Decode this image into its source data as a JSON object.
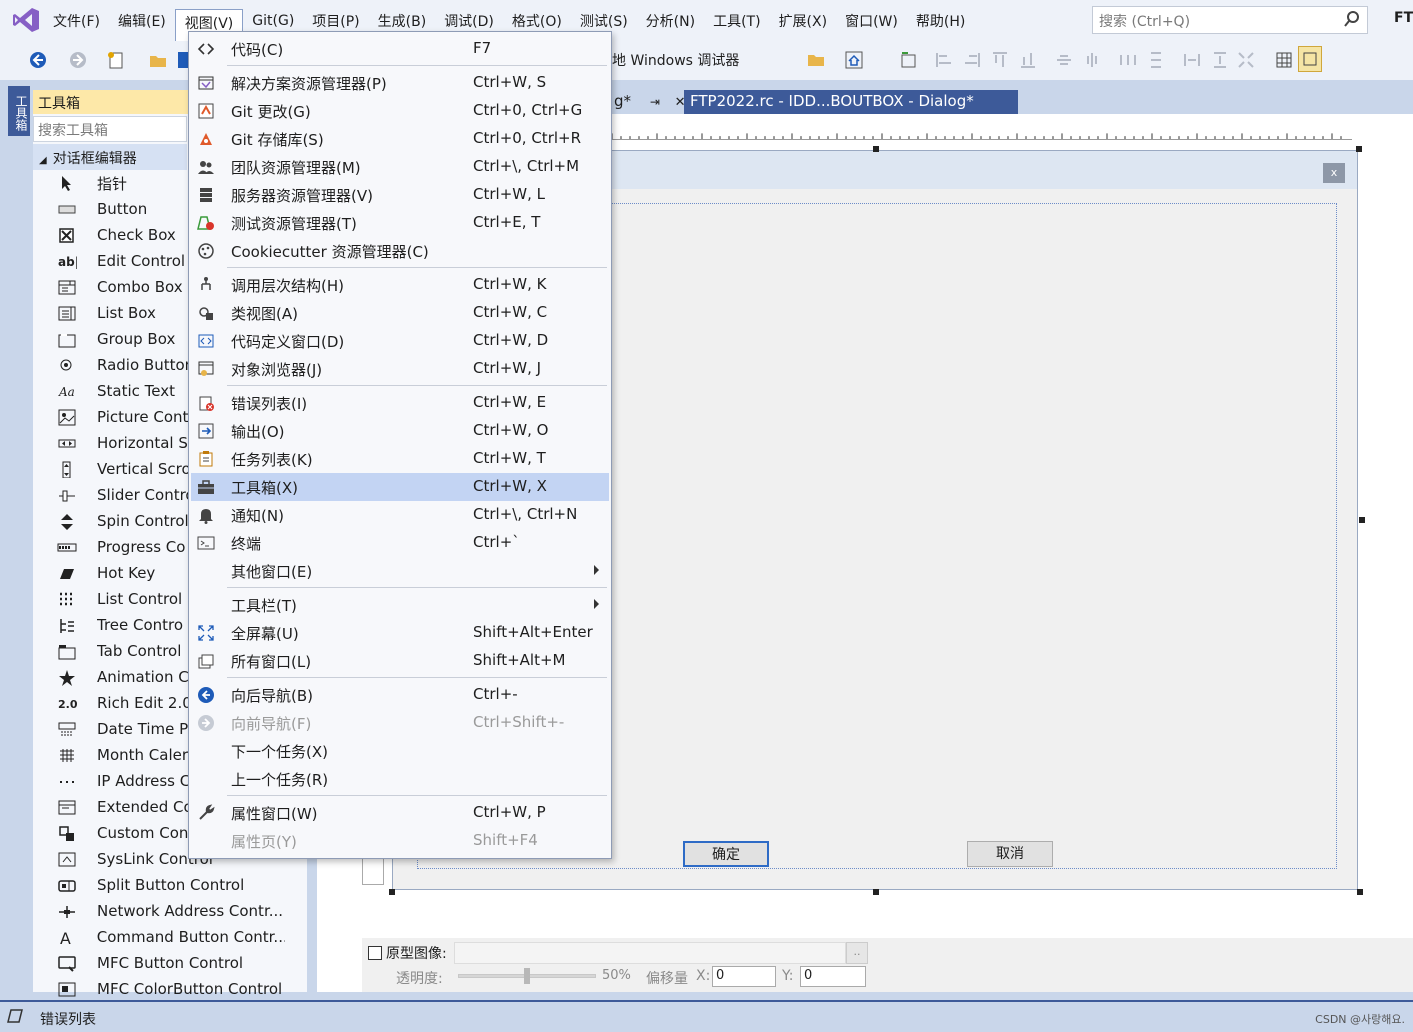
{
  "menubar": {
    "items": [
      "文件(F)",
      "编辑(E)",
      "视图(V)",
      "Git(G)",
      "项目(P)",
      "生成(B)",
      "调试(D)",
      "格式(O)",
      "测试(S)",
      "分析(N)",
      "工具(T)",
      "扩展(X)",
      "窗口(W)",
      "帮助(H)"
    ],
    "active_index": 2,
    "search_placeholder": "搜索 (Ctrl+Q)",
    "solution_label": "FT"
  },
  "toolbar": {
    "debugger_label": "地 Windows 调试器"
  },
  "side_tab": {
    "label": "工具箱"
  },
  "toolbox": {
    "title": "工具箱",
    "search_placeholder": "搜索工具箱",
    "group": "对话框编辑器",
    "items": [
      "指针",
      "Button",
      "Check Box",
      "Edit Control",
      "Combo Box",
      "List Box",
      "Group Box",
      "Radio Button",
      "Static Text",
      "Picture Cont",
      "Horizontal S",
      "Vertical Scro",
      "Slider Contro",
      "Spin Control",
      "Progress Co",
      "Hot Key",
      "List Control",
      "Tree Contro",
      "Tab Control",
      "Animation C",
      "Rich Edit 2.0",
      "Date Time Pi",
      "Month Caler",
      "IP Address C",
      "Extended Co",
      "Custom Con",
      "SysLink Control",
      "Split Button Control",
      "Network Address Contr...",
      "Command Button Contr...",
      "MFC Button Control",
      "MFC ColorButton Control"
    ]
  },
  "tabs": {
    "prev": "g*",
    "prev_pin": "⇥",
    "active": "FTP2022.rc - IDD...BOUTBOX - Dialog*",
    "close": "✕"
  },
  "dialog": {
    "close": "x",
    "ok": "确定",
    "cancel": "取消"
  },
  "proto": {
    "label": "原型图像:",
    "browse": "..",
    "opacity_label": "透明度:",
    "opacity_value": "50%",
    "opacity_fraction": 0.5,
    "offset_label": "偏移量",
    "x_label": "X:",
    "x_value": "0",
    "y_label": "Y:",
    "y_value": "0"
  },
  "bottom": {
    "label": "错误列表",
    "watermark": "CSDN @사랑해요."
  },
  "view_menu": {
    "items": [
      {
        "label": "代码(C)",
        "shortcut": "F7",
        "icon": "code-icon"
      },
      {
        "sep": true
      },
      {
        "label": "解决方案资源管理器(P)",
        "shortcut": "Ctrl+W, S",
        "icon": "solution-explorer-icon"
      },
      {
        "label": "Git 更改(G)",
        "shortcut": "Ctrl+0, Ctrl+G",
        "icon": "git-changes-icon"
      },
      {
        "label": "Git 存储库(S)",
        "shortcut": "Ctrl+0, Ctrl+R",
        "icon": "git-repository-icon"
      },
      {
        "label": "团队资源管理器(M)",
        "shortcut": "Ctrl+\\, Ctrl+M",
        "icon": "team-explorer-icon"
      },
      {
        "label": "服务器资源管理器(V)",
        "shortcut": "Ctrl+W, L",
        "icon": "server-explorer-icon"
      },
      {
        "label": "测试资源管理器(T)",
        "shortcut": "Ctrl+E, T",
        "icon": "test-explorer-icon"
      },
      {
        "label": "Cookiecutter 资源管理器(C)",
        "shortcut": "",
        "icon": "cookiecutter-icon"
      },
      {
        "sep": true
      },
      {
        "label": "调用层次结构(H)",
        "shortcut": "Ctrl+W, K",
        "icon": "call-hierarchy-icon"
      },
      {
        "label": "类视图(A)",
        "shortcut": "Ctrl+W, C",
        "icon": "class-view-icon"
      },
      {
        "label": "代码定义窗口(D)",
        "shortcut": "Ctrl+W, D",
        "icon": "code-definition-icon"
      },
      {
        "label": "对象浏览器(J)",
        "shortcut": "Ctrl+W, J",
        "icon": "object-browser-icon"
      },
      {
        "sep": true
      },
      {
        "label": "错误列表(I)",
        "shortcut": "Ctrl+W, E",
        "icon": "error-list-icon"
      },
      {
        "label": "输出(O)",
        "shortcut": "Ctrl+W, O",
        "icon": "output-icon"
      },
      {
        "label": "任务列表(K)",
        "shortcut": "Ctrl+W, T",
        "icon": "task-list-icon"
      },
      {
        "label": "工具箱(X)",
        "shortcut": "Ctrl+W, X",
        "icon": "toolbox-icon",
        "highlighted": true
      },
      {
        "label": "通知(N)",
        "shortcut": "Ctrl+\\, Ctrl+N",
        "icon": "bell-icon"
      },
      {
        "label": "终端",
        "shortcut": "Ctrl+`",
        "icon": "terminal-icon"
      },
      {
        "label": "其他窗口(E)",
        "shortcut": "",
        "icon": "",
        "submenu": true
      },
      {
        "sep": true
      },
      {
        "label": "工具栏(T)",
        "shortcut": "",
        "icon": "",
        "submenu": true
      },
      {
        "label": "全屏幕(U)",
        "shortcut": "Shift+Alt+Enter",
        "icon": "fullscreen-icon"
      },
      {
        "label": "所有窗口(L)",
        "shortcut": "Shift+Alt+M",
        "icon": "all-windows-icon"
      },
      {
        "sep": true
      },
      {
        "label": "向后导航(B)",
        "shortcut": "Ctrl+-",
        "icon": "navigate-back-icon"
      },
      {
        "label": "向前导航(F)",
        "shortcut": "Ctrl+Shift+-",
        "icon": "navigate-forward-icon",
        "disabled": true
      },
      {
        "label": "下一个任务(X)",
        "shortcut": "",
        "icon": ""
      },
      {
        "label": "上一个任务(R)",
        "shortcut": "",
        "icon": ""
      },
      {
        "sep": true
      },
      {
        "label": "属性窗口(W)",
        "shortcut": "Ctrl+W, P",
        "icon": "wrench-icon"
      },
      {
        "label": "属性页(Y)",
        "shortcut": "Shift+F4",
        "icon": "",
        "disabled": true
      }
    ]
  },
  "colors": {
    "accent": "#3d5a99",
    "highlight": "#c3d4f3",
    "background": "#c9d6ea"
  }
}
